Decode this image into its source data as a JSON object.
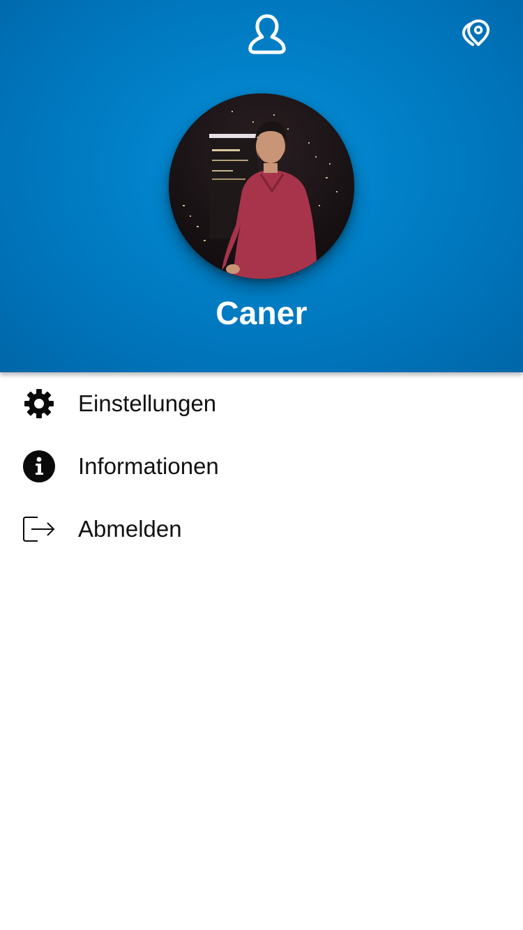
{
  "header": {
    "profile_icon": "user-outline-icon",
    "location_icon": "location-pin-icon",
    "background_color": "#0181c9",
    "user_name": "Caner",
    "avatar": "user-photo"
  },
  "menu": {
    "items": [
      {
        "label": "Einstellungen",
        "icon": "gear-icon"
      },
      {
        "label": "Informationen",
        "icon": "info-icon"
      },
      {
        "label": "Abmelden",
        "icon": "logout-icon"
      }
    ]
  }
}
